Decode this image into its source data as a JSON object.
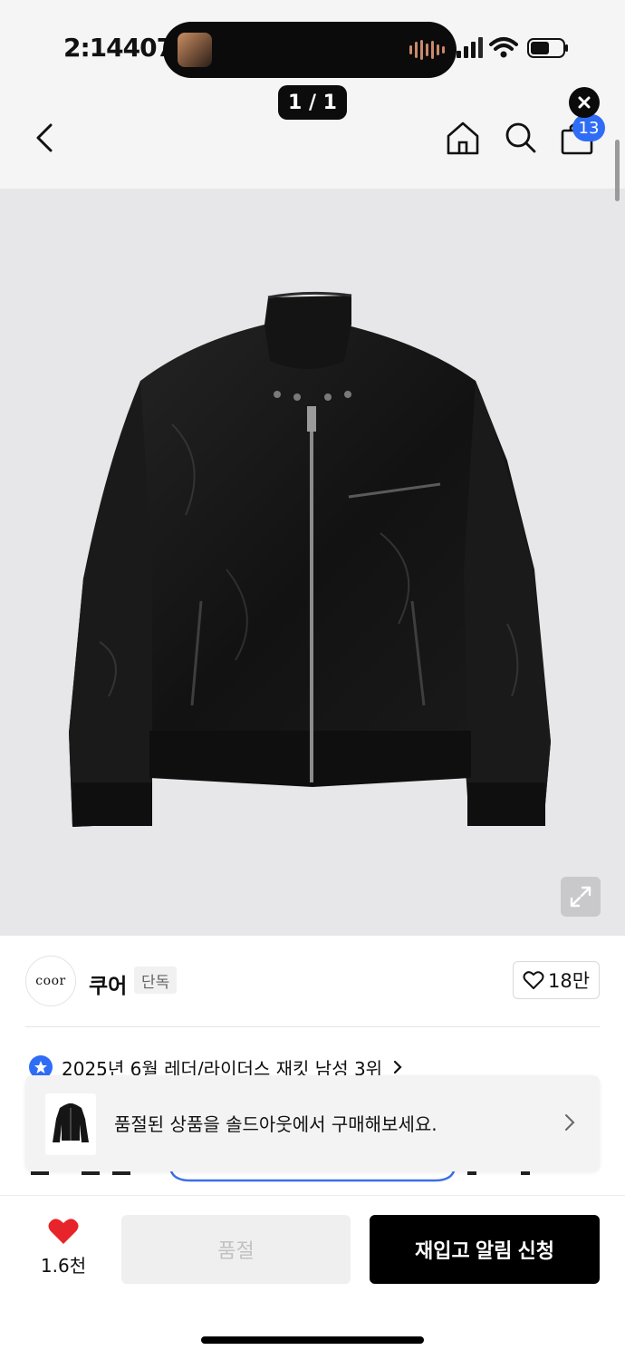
{
  "status_bar": {
    "time": "2:14407"
  },
  "image_counter": "1 / 1",
  "nav": {
    "cart_count": "13"
  },
  "product": {
    "image_alt": "black leather rider jacket"
  },
  "brand": {
    "logo_text": "coor",
    "name": "쿠어",
    "tag": "단독",
    "likes": "18만"
  },
  "ranking": {
    "text": "2025년 6월 레더/라이더스 재킷 남성 3위"
  },
  "soldout_banner": {
    "text": "품절된 상품을 솔드아웃에서 구매해보세요."
  },
  "bottom": {
    "wishlist_count": "1.6천",
    "soldout_label": "품절",
    "restock_label": "재입고 알림 신청"
  },
  "colors": {
    "accent": "#2f6df6",
    "heart": "#e8242b",
    "primary_button": "#000000"
  }
}
